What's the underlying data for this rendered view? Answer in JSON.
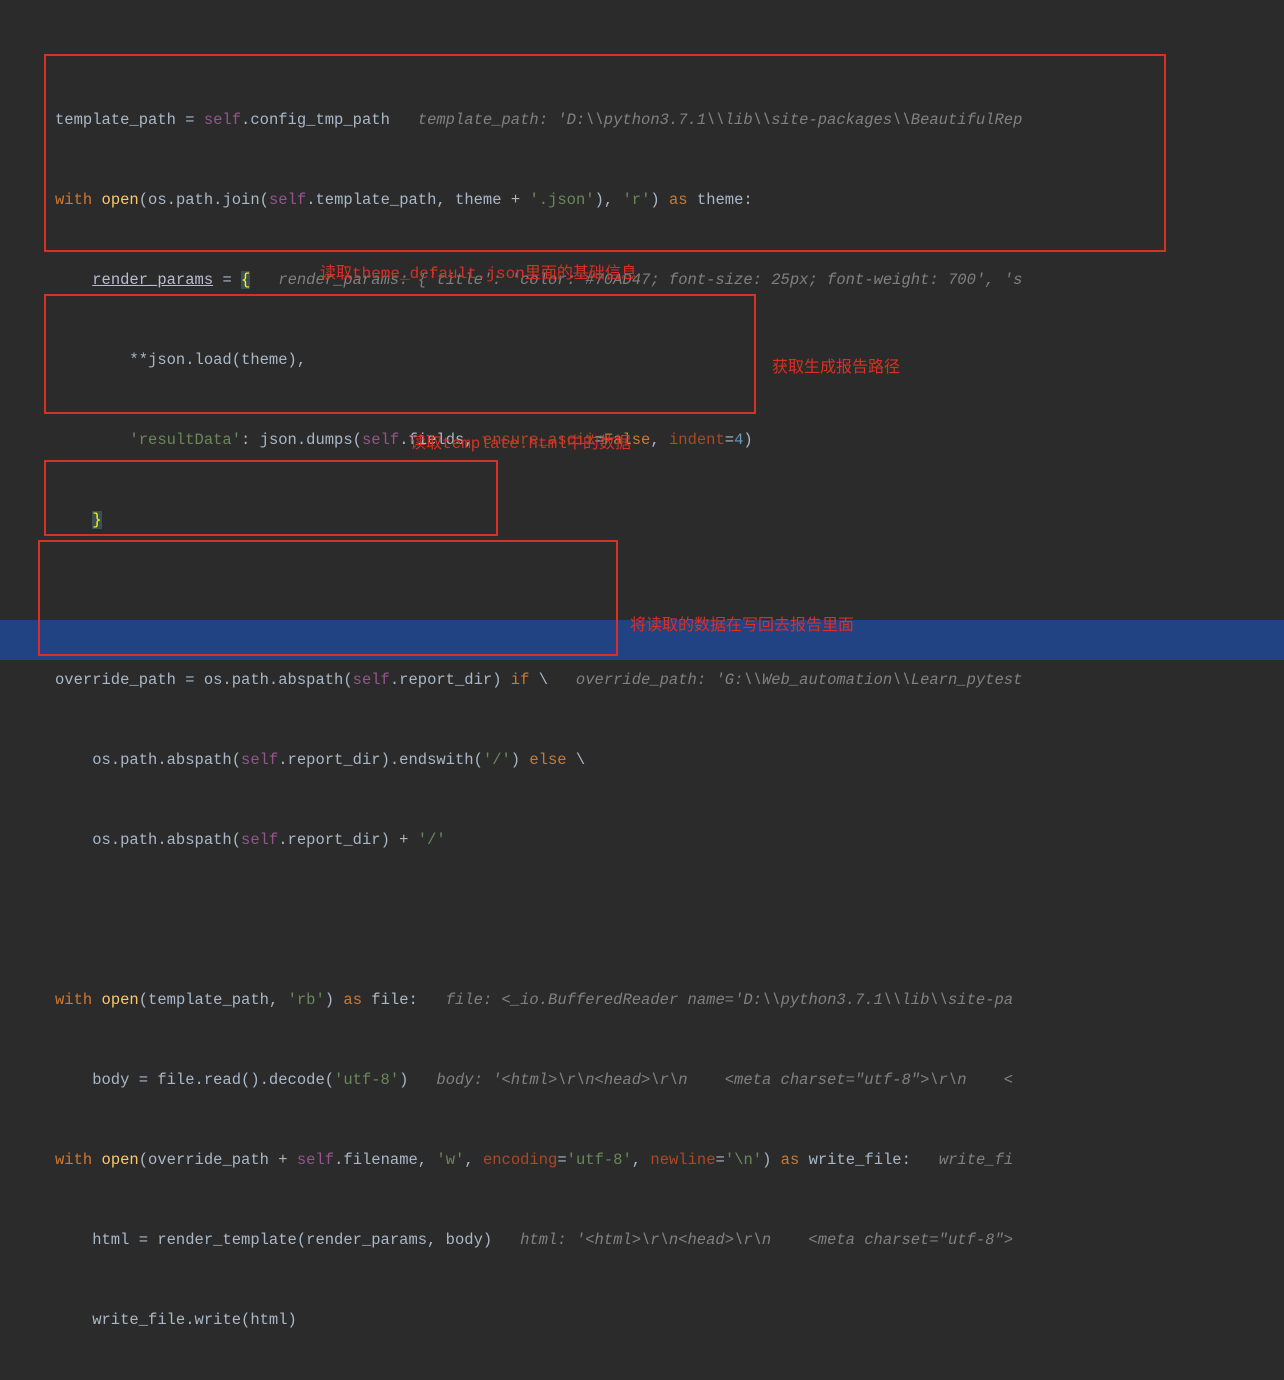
{
  "code": {
    "l1_a": "template_path = ",
    "l1_self": "self",
    "l1_b": ".config_tmp_path   ",
    "l1_c": "template_path: 'D:\\\\python3.7.1\\\\lib\\\\site-packages\\\\BeautifulRep",
    "l2_with": "with",
    "l2_open": " open",
    "l2_a": "(os.path.join(",
    "l2_self": "self",
    "l2_b": ".template_path, theme + ",
    "l2_str": "'.json'",
    "l2_c": "), ",
    "l2_str2": "'r'",
    "l2_d": ") ",
    "l2_as": "as",
    "l2_e": " theme:",
    "l3_a": "    ",
    "l3_rp": "render_params",
    "l3_b": " = ",
    "l3_brace": "{",
    "l3_c": "   ",
    "l3_comment": "render_params: {'title': 'color: #70AD47; font-size: 25px; font-weight: 700', 's",
    "l4_a": "        **json.load(theme),",
    "l5_a": "        ",
    "l5_str": "'resultData'",
    "l5_b": ": json.dumps(",
    "l5_self": "self",
    "l5_c": ".fields, ",
    "l5_p1": "ensure_ascii",
    "l5_d": "=",
    "l5_kw": "False",
    "l5_e": ", ",
    "l5_p2": "indent",
    "l5_f": "=",
    "l5_num": "4",
    "l5_g": ")",
    "l6_a": "    ",
    "l6_brace": "}",
    "l8_a": "override_path = os.path.abspath(",
    "l8_self": "self",
    "l8_b": ".report_dir) ",
    "l8_if": "if",
    "l8_c": " \\   ",
    "l8_comment": "override_path: 'G:\\\\Web_automation\\\\Learn_pytest",
    "l9_a": "    os.path.abspath(",
    "l9_self": "self",
    "l9_b": ".report_dir).endswith(",
    "l9_str": "'/'",
    "l9_c": ") ",
    "l9_else": "else",
    "l9_d": " \\",
    "l10_a": "    os.path.abspath(",
    "l10_self": "self",
    "l10_b": ".report_dir) + ",
    "l10_str": "'/'",
    "l12_with": "with",
    "l12_open": " open",
    "l12_a": "(template_path, ",
    "l12_str": "'rb'",
    "l12_b": ") ",
    "l12_as": "as",
    "l12_c": " file:   ",
    "l12_comment": "file: <_io.BufferedReader name='D:\\\\python3.7.1\\\\lib\\\\site-pa",
    "l13_a": "    body = file.read().decode(",
    "l13_str": "'utf-8'",
    "l13_b": ")   ",
    "l13_comment": "body: '<html>\\r\\n<head>\\r\\n    <meta charset=\"utf-8\">\\r\\n    <",
    "l14_with": "with",
    "l14_open": " open",
    "l14_a": "(override_path + ",
    "l14_self": "self",
    "l14_b": ".filename, ",
    "l14_str1": "'w'",
    "l14_c": ", ",
    "l14_p1": "encoding",
    "l14_d": "=",
    "l14_str2": "'utf-8'",
    "l14_e": ", ",
    "l14_p2": "newline",
    "l14_f": "=",
    "l14_str3": "'\\n'",
    "l14_g": ") ",
    "l14_as": "as",
    "l14_h": " write_file:   ",
    "l14_comment": "write_fi",
    "l15_a": "    html = render_template(render_params, body)   ",
    "l15_comment": "html: '<html>\\r\\n<head>\\r\\n    <meta charset=\"utf-8\">",
    "l16_a": "    write_file.write(html)"
  },
  "annotations": {
    "a1": "读取theme_default.json里面的基础信息",
    "a2": "获取生成报告路径",
    "a3": "读取template.html中的数据",
    "a4": "将读取的数据在写回去报告里面"
  }
}
